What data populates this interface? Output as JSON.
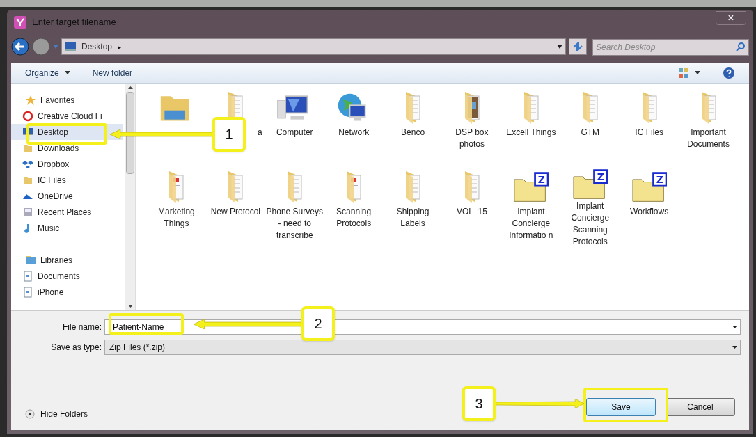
{
  "window": {
    "title": "Enter target filename",
    "close": "×"
  },
  "address": {
    "path": "Desktop",
    "separator": "▸"
  },
  "search": {
    "placeholder": "Search Desktop"
  },
  "toolbar": {
    "organize": "Organize",
    "new_folder": "New folder"
  },
  "sidebar": [
    {
      "label": "Favorites",
      "kind": "star",
      "children": [
        {
          "label": "Creative Cloud Fi",
          "kind": "cloud-red",
          "selected": false
        },
        {
          "label": "Desktop",
          "kind": "desktop",
          "selected": true
        },
        {
          "label": "Downloads",
          "kind": "folder",
          "selected": false
        },
        {
          "label": "Dropbox",
          "kind": "dropbox",
          "selected": false
        },
        {
          "label": "IC Files",
          "kind": "folder",
          "selected": false
        },
        {
          "label": "OneDrive",
          "kind": "cloud-blue",
          "selected": false
        },
        {
          "label": "Recent Places",
          "kind": "recent",
          "selected": false
        },
        {
          "label": "Music",
          "kind": "music",
          "selected": false
        }
      ]
    },
    {
      "label": "Libraries",
      "kind": "library",
      "children": [
        {
          "label": "Documents",
          "kind": "document",
          "selected": false
        },
        {
          "label": "iPhone",
          "kind": "document",
          "selected": false
        }
      ]
    }
  ],
  "files": [
    {
      "kind": "library"
    },
    {
      "label": "a",
      "kind": "folder"
    },
    {
      "label": "Computer",
      "kind": "computer"
    },
    {
      "label": "Network",
      "kind": "network"
    },
    {
      "label": "Benco",
      "kind": "folder"
    },
    {
      "label": "DSP box photos",
      "kind": "photo-folder"
    },
    {
      "label": "Excell Things",
      "kind": "folder"
    },
    {
      "label": "GTM",
      "kind": "folder"
    },
    {
      "label": "IC Files",
      "kind": "folder"
    },
    {
      "label": "Important Documents",
      "kind": "folder"
    },
    {
      "label": "Marketing Things",
      "kind": "red-folder"
    },
    {
      "label": "New Protocol",
      "kind": "folder"
    },
    {
      "label": "Phone Surveys - need to transcribe",
      "kind": "folder"
    },
    {
      "label": "Scanning Protocols",
      "kind": "red-folder"
    },
    {
      "label": "Shipping Labels",
      "kind": "folder"
    },
    {
      "label": "VOL_15",
      "kind": "folder"
    },
    {
      "label": "Implant Concierge Informatio n",
      "kind": "zip-folder",
      "badge": "Z"
    },
    {
      "label": "Implant Concierge Scanning Protocols",
      "kind": "zip-folder",
      "badge": "Z"
    },
    {
      "label": "Workflows",
      "kind": "zip-folder",
      "badge": "Z"
    }
  ],
  "file_name": {
    "label": "File name:",
    "value": "Patient-Name"
  },
  "save_as_type": {
    "label": "Save as type:",
    "value": "Zip Files (*.zip)"
  },
  "hide_folders": "Hide Folders",
  "buttons": [
    {
      "label": "Save",
      "default": true
    },
    {
      "label": "Cancel",
      "default": false
    }
  ],
  "callouts": [
    {
      "number": "1"
    },
    {
      "number": "2"
    },
    {
      "number": "3"
    }
  ]
}
